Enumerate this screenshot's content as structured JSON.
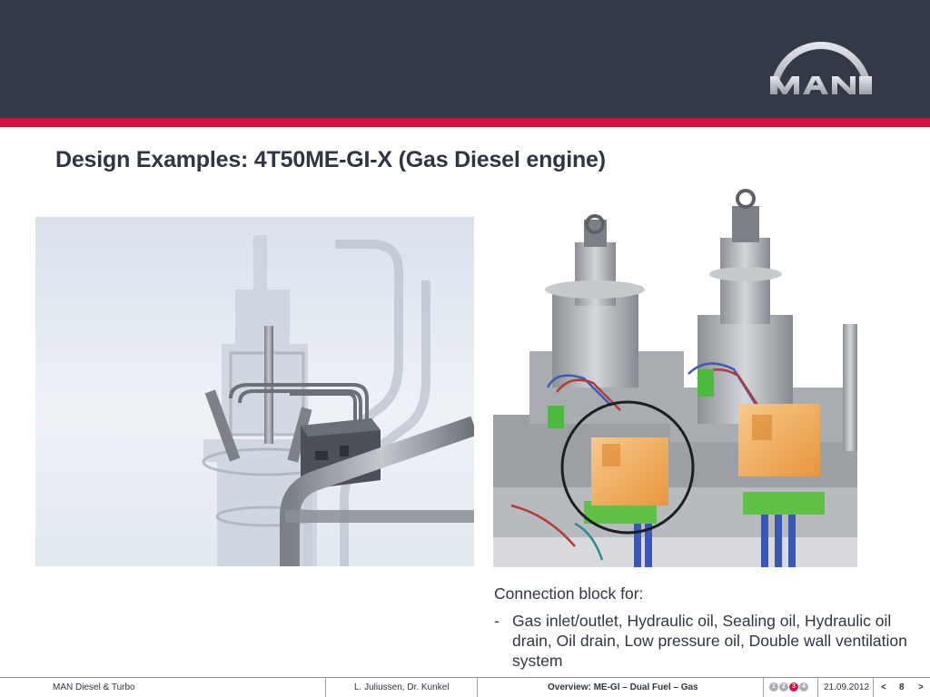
{
  "header": {
    "brand_logo": "MAN",
    "brand_color": "#323a47",
    "accent_color": "#d6103f"
  },
  "title": "Design Examples: 4T50ME-GI-X (Gas Diesel engine)",
  "images": {
    "left": "engine-cutaway-render",
    "right": "connection-block-render"
  },
  "caption": {
    "heading": "Connection block for:",
    "bullet_marker": "-",
    "bullets": [
      "Gas inlet/outlet, Hydraulic oil, Sealing oil, Hydraulic oil drain, Oil drain, Low pressure oil, Double wall ventilation system"
    ]
  },
  "footer": {
    "company": "MAN Diesel & Turbo",
    "authors": "L. Juliussen, Dr. Kunkel",
    "topic": "Overview: ME-GI – Dual Fuel – Gas",
    "sections": [
      "1",
      "2",
      "3",
      "4"
    ],
    "active_section": 3,
    "date": "21.09.2012",
    "prev": "<",
    "page": "8",
    "next": ">"
  }
}
